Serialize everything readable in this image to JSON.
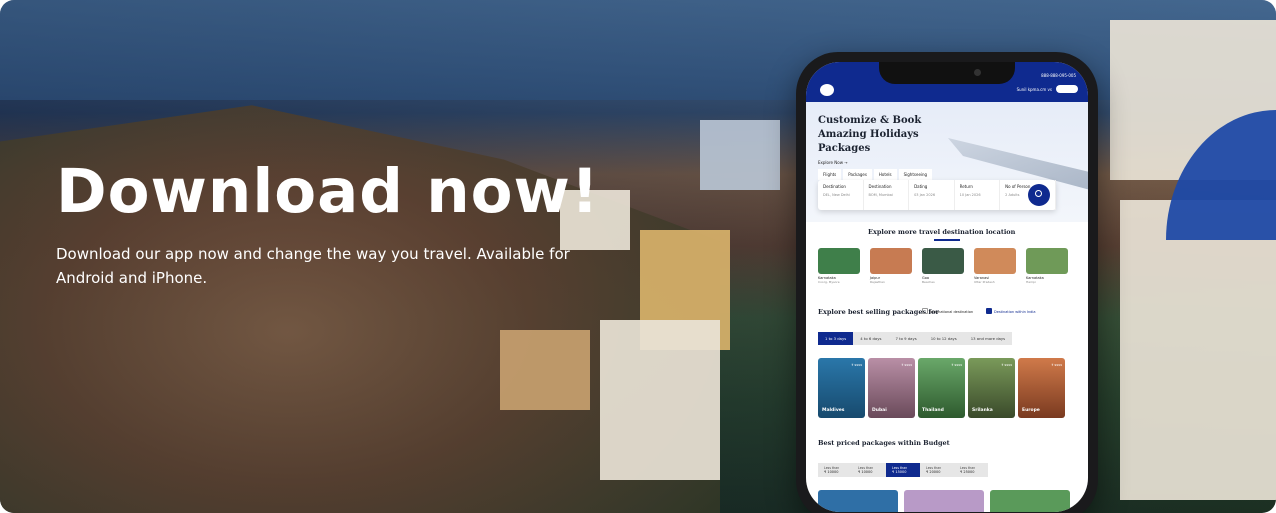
{
  "banner": {
    "heading": "Download now!",
    "subtext": "Download our app now and change the way you travel. Available for Android and iPhone."
  },
  "phone": {
    "status_right": "888-888-095-005",
    "topbar_link": "Sunil kpma.cm vs",
    "hero": {
      "title": "Customize & Book Amazing Holidays Packages",
      "explore_link": "Explore Now →"
    },
    "tabs": [
      "Flights",
      "Packages",
      "Hotels",
      "Sightseeing"
    ],
    "search_fields": [
      {
        "label": "Destination",
        "value": "DEL, New Delhi"
      },
      {
        "label": "Destination",
        "value": "BOM, Mumbai"
      },
      {
        "label": "Dating",
        "value": "03 Jan 2026"
      },
      {
        "label": "Return",
        "value": "10 Jan 2026"
      },
      {
        "label": "No of Person",
        "value": "2 Adults"
      }
    ],
    "explore_title": "Explore more travel destination location",
    "destinations": [
      {
        "name": "Karnataka",
        "sub": "Coorg, Mysore",
        "color": "#3f7f4a"
      },
      {
        "name": "Jaipur",
        "sub": "Rajasthan",
        "color": "#c77b52"
      },
      {
        "name": "Goa",
        "sub": "Beaches",
        "color": "#3a5a46"
      },
      {
        "name": "Varanasi",
        "sub": "Uttar Pradesh",
        "color": "#d08a5a"
      },
      {
        "name": "Karnataka",
        "sub": "Hampi",
        "color": "#6f9a58"
      }
    ],
    "best_selling_title": "Explore best selling packages for",
    "options": [
      "International destination",
      "Destination within India"
    ],
    "day_filters": [
      "1 to 3 days",
      "4 to 6 days",
      "7 to 9 days",
      "10 to 12 days",
      "13 and more days"
    ],
    "active_day_index": 0,
    "packages": [
      {
        "name": "Maldives",
        "price": "₹ 9999",
        "color": "#1f5f8a"
      },
      {
        "name": "Dubai",
        "price": "₹ 9999",
        "color": "#8a6a7a"
      },
      {
        "name": "Thailand",
        "price": "₹ 9999",
        "color": "#3e7a3e"
      },
      {
        "name": "Srilanka",
        "price": "₹ 9999",
        "color": "#4e6b3a"
      },
      {
        "name": "Europe",
        "price": "₹ 9999",
        "color": "#a04a2f"
      }
    ],
    "budget_title": "Best priced packages within Budget",
    "budgets": [
      {
        "l1": "Less than",
        "l2": "₹ 10000"
      },
      {
        "l1": "Less than",
        "l2": "₹ 10000"
      },
      {
        "l1": "Less than",
        "l2": "₹ 15000"
      },
      {
        "l1": "Less than",
        "l2": "₹ 20000"
      },
      {
        "l1": "Less than",
        "l2": "₹ 25000"
      }
    ],
    "active_budget_index": 2,
    "bottom_colors": [
      "#2f6fa6",
      "#b89ac7",
      "#5a9a5a"
    ]
  }
}
